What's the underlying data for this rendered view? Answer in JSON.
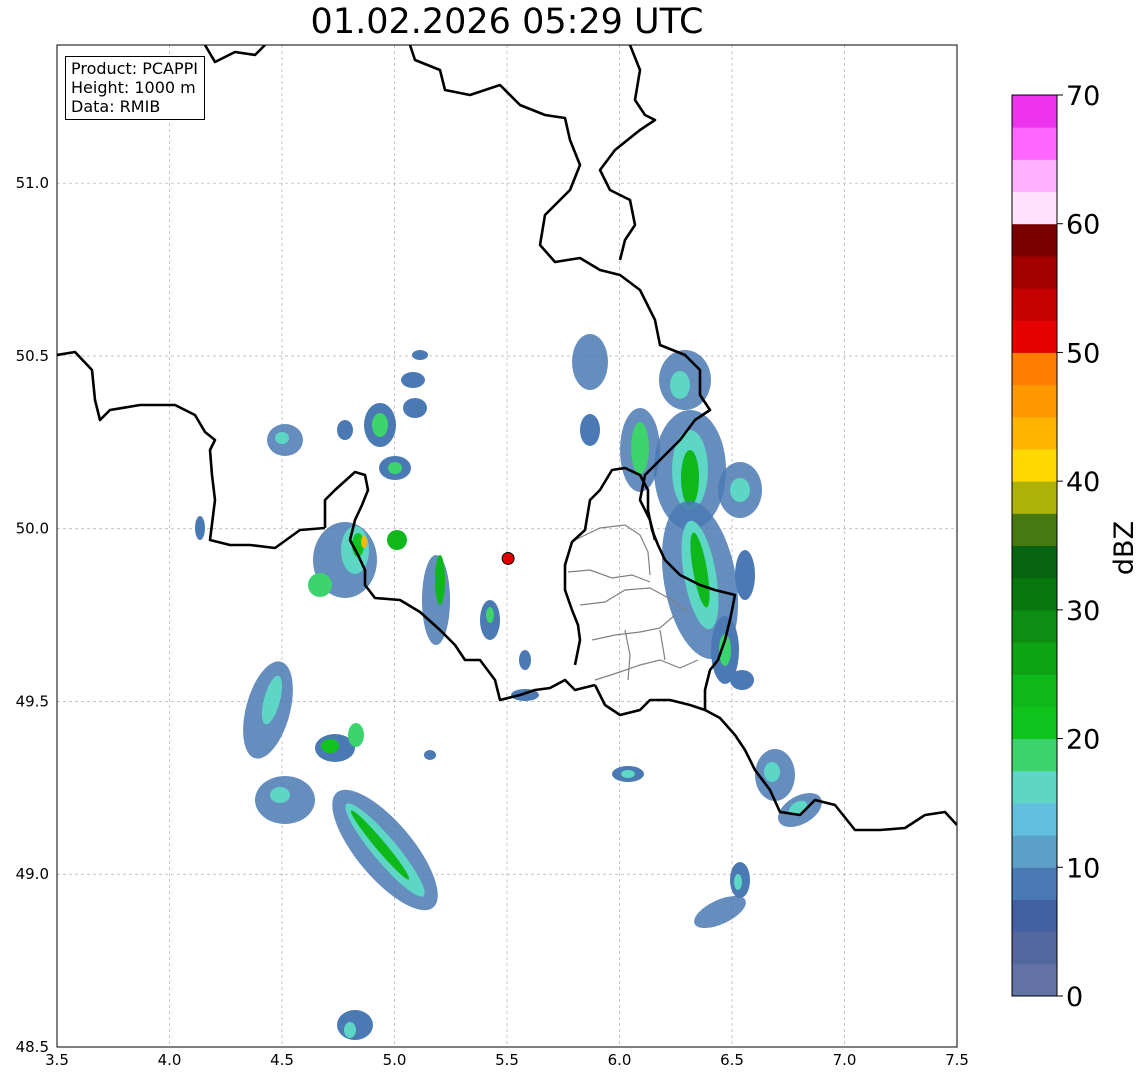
{
  "title": "01.02.2026 05:29 UTC",
  "info": {
    "product": "Product: PCAPPI",
    "height": "Height: 1000 m",
    "data": "Data: RMIB"
  },
  "axes": {
    "x_ticks": [
      "3.5",
      "4.0",
      "4.5",
      "5.0",
      "5.5",
      "6.0",
      "6.5",
      "7.0",
      "7.5"
    ],
    "y_ticks": [
      "48.5",
      "49.0",
      "49.5",
      "50.0",
      "50.5",
      "51.0"
    ],
    "xlim": [
      3.5,
      7.5
    ],
    "ylim": [
      48.5,
      51.4
    ]
  },
  "colorbar": {
    "unit": "dBZ",
    "ticks": [
      "0",
      "10",
      "20",
      "30",
      "40",
      "50",
      "60",
      "70"
    ],
    "range": [
      0,
      70
    ],
    "colors": [
      "#6272a6",
      "#5468a0",
      "#4360a2",
      "#4a79b3",
      "#5aa0c8",
      "#62c0de",
      "#5ed6c6",
      "#3dd46e",
      "#11c41d",
      "#0fb81a",
      "#0ea315",
      "#0d8d12",
      "#0a7610",
      "#086410",
      "#467a10",
      "#afb208",
      "#ffd800",
      "#ffb400",
      "#ff9800",
      "#ff7e00",
      "#e60000",
      "#c40000",
      "#a30000",
      "#7a0000",
      "#ffe0ff",
      "#ffb0ff",
      "#ff66ff",
      "#ee33ee"
    ]
  },
  "radar_site": {
    "lon": 5.505,
    "lat": 49.914,
    "color": "#e00000"
  }
}
